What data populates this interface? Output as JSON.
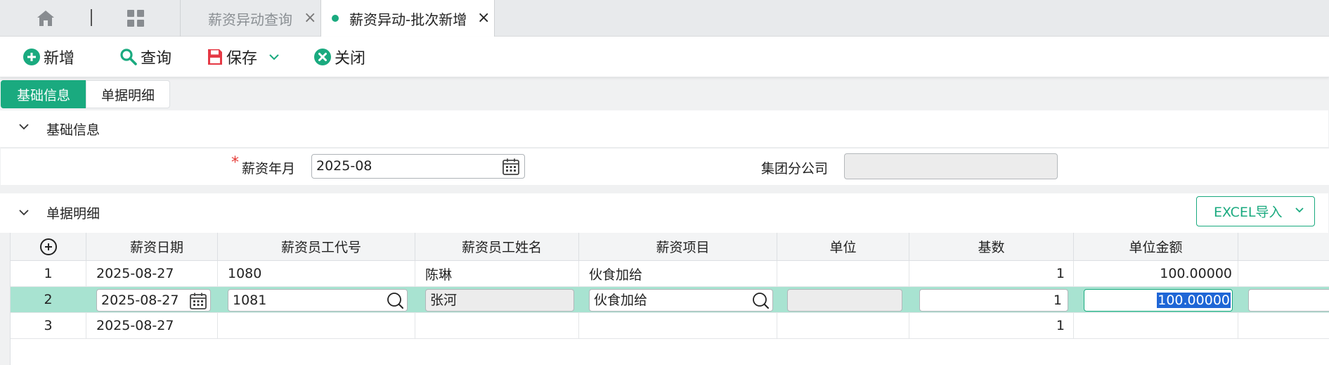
{
  "tabs": {
    "items": [
      {
        "label": "薪资异动查询",
        "close": "×"
      },
      {
        "label": "薪资异动-批次新增",
        "close": "×"
      }
    ],
    "active_color": "#1aaa7f"
  },
  "toolbar": {
    "add_label": "新增",
    "query_label": "查询",
    "save_label": "保存",
    "close_label": "关闭"
  },
  "section_tabs": [
    "基础信息",
    "单据明细"
  ],
  "basic": {
    "title": "基础信息",
    "period_label": "薪资年月",
    "period_required": "*",
    "period_value": "2025-08",
    "group_label": "集团分公司",
    "group_value": ""
  },
  "detail": {
    "title": "单据明细",
    "excel_button": "EXCEL导入",
    "columns": [
      "薪资日期",
      "薪资员工代号",
      "薪资员工姓名",
      "薪资项目",
      "单位",
      "基数",
      "单位金额"
    ],
    "rows": [
      {
        "no": "1",
        "date": "2025-08-27",
        "emp_id": "1080",
        "emp_name": "陈琳",
        "item": "伙食加给",
        "unit": "",
        "base": "1",
        "amount": "100.00000"
      },
      {
        "no": "2",
        "date": "2025-08-27",
        "emp_id": "1081",
        "emp_name": "张河",
        "item": "伙食加给",
        "unit": "",
        "base": "1",
        "amount": "100.00000"
      },
      {
        "no": "3",
        "date": "2025-08-27",
        "emp_id": "",
        "emp_name": "",
        "item": "",
        "unit": "",
        "base": "1",
        "amount": ""
      }
    ],
    "selected_row": "2"
  },
  "icons": {
    "home": "home-icon",
    "apps": "grid-icon",
    "add": "plus-circle-icon",
    "query": "search-icon",
    "save": "floppy-disk-icon",
    "close": "close-circle-icon",
    "calendar": "calendar-icon",
    "lookup": "search-icon"
  },
  "colors": {
    "accent": "#1aaa7f",
    "selected_row": "#a8e3d1",
    "save_icon": "#e53945",
    "query_icon": "#1aaa7f",
    "required": "#e53935"
  }
}
